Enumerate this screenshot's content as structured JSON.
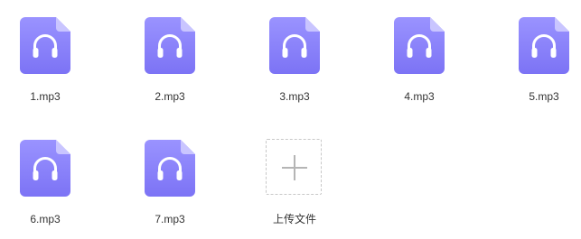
{
  "colors": {
    "icon_gradient_top": "#9A93FF",
    "icon_gradient_bottom": "#7C73F5",
    "icon_fold": "#C9C5FF",
    "headphones": "#ffffff"
  },
  "icons": {
    "file": "headphones-audio-file-icon",
    "upload": "plus-icon"
  },
  "files": [
    {
      "name": "1.mp3"
    },
    {
      "name": "2.mp3"
    },
    {
      "name": "3.mp3"
    },
    {
      "name": "4.mp3"
    },
    {
      "name": "5.mp3"
    },
    {
      "name": "6.mp3"
    },
    {
      "name": "7.mp3"
    }
  ],
  "upload": {
    "label": "上传文件"
  }
}
